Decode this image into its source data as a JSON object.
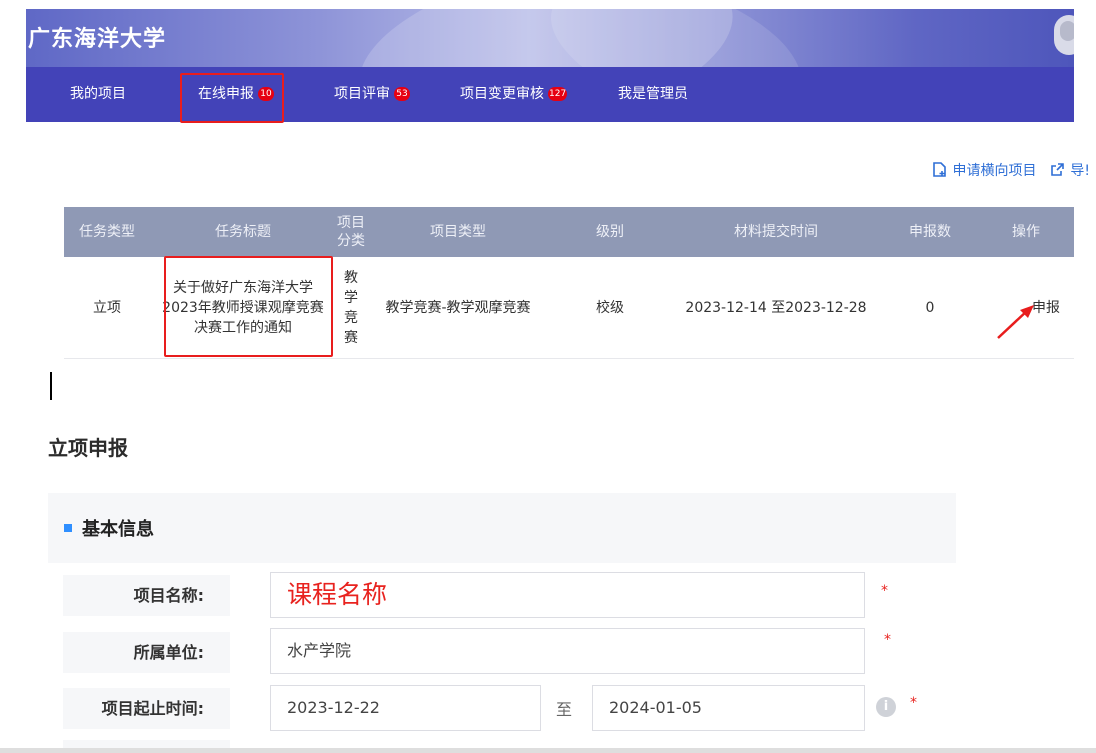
{
  "header": {
    "university_name": "广东海洋大学"
  },
  "nav": {
    "items": [
      {
        "label": "我的项目",
        "badge": ""
      },
      {
        "label": "在线申报",
        "badge": "10"
      },
      {
        "label": "项目评审",
        "badge": "53"
      },
      {
        "label": "项目变更审核",
        "badge": "127"
      },
      {
        "label": "我是管理员",
        "badge": ""
      }
    ]
  },
  "toolbar": {
    "apply_horizontal": "申请横向项目",
    "export": "导!"
  },
  "table": {
    "columns": [
      "任务类型",
      "任务标题",
      "项目\n分类",
      "项目类型",
      "级别",
      "材料提交时间",
      "申报数",
      "操作"
    ],
    "rows": [
      {
        "task_type": "立项",
        "task_title": "关于做好广东海洋大学2023年教师授课观摩竞赛决赛工作的通知",
        "category": "教学\n竞赛",
        "project_type": "教学竞赛-教学观摩竞赛",
        "level": "校级",
        "submit_time": "2023-12-14 至2023-12-28",
        "count": "0",
        "action": "申报"
      }
    ]
  },
  "form": {
    "section_title": "立项申报",
    "group_title": "基本信息",
    "project_name_label": "项目名称:",
    "project_name_value": "课程名称",
    "unit_label": "所属单位:",
    "unit_value": "水产学院",
    "period_label": "项目起止时间:",
    "start_date": "2023-12-22",
    "range_sep": "至",
    "end_date": "2024-01-05",
    "required_mark": "*",
    "info_icon": "i"
  },
  "colors": {
    "nav_bg": "#4343b8",
    "highlight": "#e81d1d",
    "link": "#2f6fd6",
    "badge": "#e60012"
  }
}
